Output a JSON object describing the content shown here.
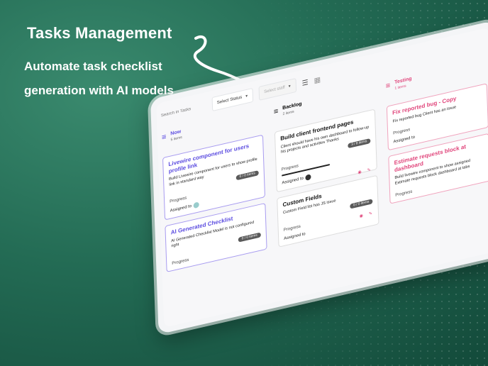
{
  "hero": {
    "headline": "Tasks Management",
    "subtitle_line1": "Automate task checklist",
    "subtitle_line2": "generation with AI models"
  },
  "toolbar": {
    "search_placeholder": "Search in Tasks",
    "status_select": "Select Status",
    "staff_select": "Select staff"
  },
  "columns": [
    {
      "title": "Now",
      "count": "5 items",
      "cards": [
        {
          "title": "Livewire component for users profile link",
          "desc": "Build Livewire component for users to show profile link in standard way",
          "badge": "0 / 0 items",
          "progress_label": "Progress",
          "assigned_label": "Assigned to"
        },
        {
          "title": "AI Generated Checklist",
          "desc": "AI Generated Checklist Model is not configured right",
          "badge": "0 / 0 items",
          "progress_label": "Progress",
          "assigned_label": ""
        }
      ]
    },
    {
      "title": "Backlog",
      "count": "2 items",
      "cards": [
        {
          "title": "Build client frontend pages",
          "desc": "Client should have his own dashboard to follow-up his projects and activities Thanks",
          "badge": "3 / 8 items",
          "progress_label": "Progress",
          "assigned_label": "Assigned to"
        },
        {
          "title": "Custom Fields",
          "desc": "Custom Field list has JS issue",
          "badge": "0 / 0 items",
          "progress_label": "Progress",
          "assigned_label": "Assigned to"
        }
      ]
    },
    {
      "title": "Testing",
      "count": "1 items",
      "cards": [
        {
          "title": "Fix reported bug - Copy",
          "desc": "Fix reported bug Client has an issue",
          "badge": "",
          "progress_label": "Progress",
          "assigned_label": "Assigned to"
        },
        {
          "title": "Estimate requests block at dashboard",
          "desc": "Build livewire component to show assigned Estimate requests block dashboard at tabs",
          "badge": "",
          "progress_label": "Progress",
          "assigned_label": ""
        }
      ]
    }
  ],
  "colors": {
    "purple": "#5b4ce0",
    "pink": "#e0457b",
    "background": "#236b54"
  },
  "icons": [
    "list-icon",
    "grid-icon",
    "eye-icon",
    "edit-icon",
    "chevron-down-icon"
  ]
}
